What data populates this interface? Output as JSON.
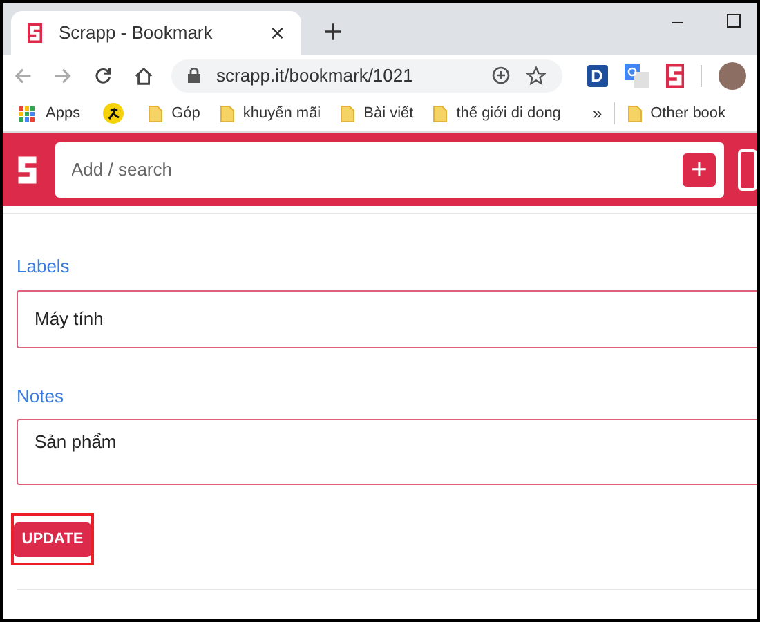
{
  "tab": {
    "title": "Scrapp - Bookmark",
    "close": "×",
    "new_tab": "+"
  },
  "window_controls": {
    "minimize": "–"
  },
  "address_bar": {
    "url": "scrapp.it/bookmark/1021"
  },
  "extensions": [
    {
      "kind": "letter",
      "label": "D"
    },
    {
      "kind": "translate"
    },
    {
      "kind": "scrapp"
    }
  ],
  "bookmarks": [
    {
      "kind": "apps",
      "label": "Apps"
    },
    {
      "kind": "site"
    },
    {
      "kind": "folder",
      "label": "Góp"
    },
    {
      "kind": "folder",
      "label": "khuyến mãi"
    },
    {
      "kind": "folder",
      "label": "Bài viết"
    },
    {
      "kind": "folder",
      "label": "thế giới di dong"
    }
  ],
  "bookmarks_more": "»",
  "other_bookmarks": "Other book",
  "app_header": {
    "search": {
      "placeholder": "Add / search"
    },
    "add_button": "+"
  },
  "form": {
    "fields": [
      {
        "kind": "input",
        "label": "Labels",
        "value": "Máy tính"
      },
      {
        "kind": "textarea",
        "label": "Notes",
        "value": "Sản phẩm"
      }
    ],
    "submit": {
      "label": "UPDATE",
      "highlighted": true
    }
  }
}
